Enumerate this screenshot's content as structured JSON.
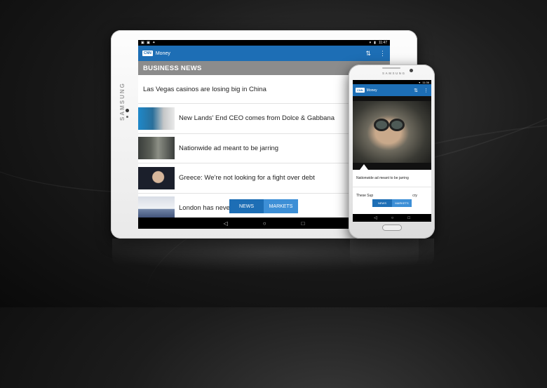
{
  "tablet": {
    "brand": "SAMSUNG",
    "status_time": "11:47",
    "app": {
      "logo": "CNN",
      "title": "Money"
    },
    "section_header": "BUSINESS NEWS",
    "articles": [
      {
        "headline": "Las Vegas casinos are losing big in China"
      },
      {
        "headline": "New Lands' End CEO comes from Dolce & Gabbana"
      },
      {
        "headline": "Nationwide ad meant to be jarring"
      },
      {
        "headline": "Greece: We're not looking for a fight over debt"
      },
      {
        "headline": "London has never b"
      }
    ],
    "tabs": [
      {
        "label": "NEWS"
      },
      {
        "label": "MARKETS"
      }
    ],
    "nav": {
      "back": "◁",
      "home": "○",
      "recent": "□"
    },
    "icons": {
      "sort": "sort-arrows-icon",
      "menu": "overflow-menu-icon"
    }
  },
  "phone": {
    "brand": "SAMSUNG",
    "status_time": "11:36",
    "app": {
      "logo": "CNN",
      "title": "Money"
    },
    "headline_1": "Nationwide ad meant to be jarring",
    "headline_2": "These Sup",
    "headline_2_tail": "cry",
    "tabs": [
      {
        "label": "NEWS"
      },
      {
        "label": "MARKETS"
      }
    ],
    "nav": {
      "back": "◁",
      "home": "○",
      "recent": "□"
    }
  },
  "colors": {
    "accent": "#1d6eb5",
    "tab_inactive": "#3d8fd6",
    "section_header": "#8c8c8c"
  }
}
